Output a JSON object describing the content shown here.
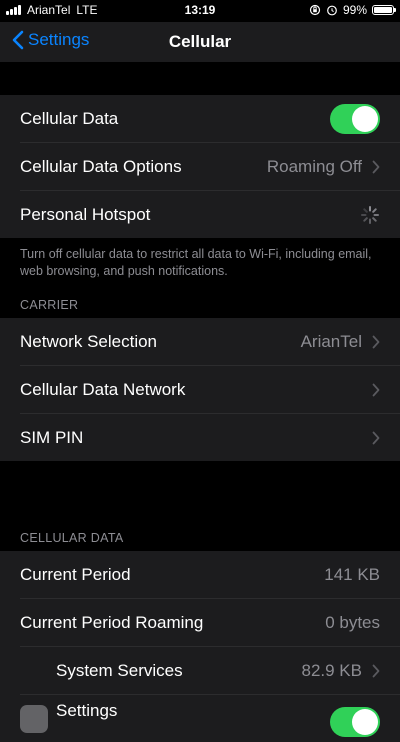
{
  "status_bar": {
    "carrier": "ArianTel",
    "network": "LTE",
    "time": "13:19",
    "battery": "99%",
    "battery_level": 0.99
  },
  "nav": {
    "back_label": "Settings",
    "title": "Cellular"
  },
  "section_main": {
    "rows": [
      {
        "label": "Cellular Data",
        "toggle_on": true
      },
      {
        "label": "Cellular Data Options",
        "value": "Roaming Off"
      },
      {
        "label": "Personal Hotspot",
        "status": "loading"
      }
    ],
    "footer": "Turn off cellular data to restrict all data to Wi-Fi, including email, web browsing, and push notifications."
  },
  "section_carrier": {
    "header": "CARRIER",
    "rows": [
      {
        "label": "Network Selection",
        "value": "ArianTel"
      },
      {
        "label": "Cellular Data Network"
      },
      {
        "label": "SIM PIN"
      }
    ]
  },
  "section_data": {
    "header": "CELLULAR DATA",
    "rows": [
      {
        "label": "Current Period",
        "value": "141 KB"
      },
      {
        "label": "Current Period Roaming",
        "value": "0 bytes"
      },
      {
        "label": "System Services",
        "value": "82.9 KB"
      },
      {
        "label": "Settings"
      }
    ]
  },
  "colors": {
    "accent": "#0a84ff",
    "toggle_on": "#30d158",
    "cell_bg": "#1c1c1e",
    "secondary_text": "#8d8d93"
  }
}
